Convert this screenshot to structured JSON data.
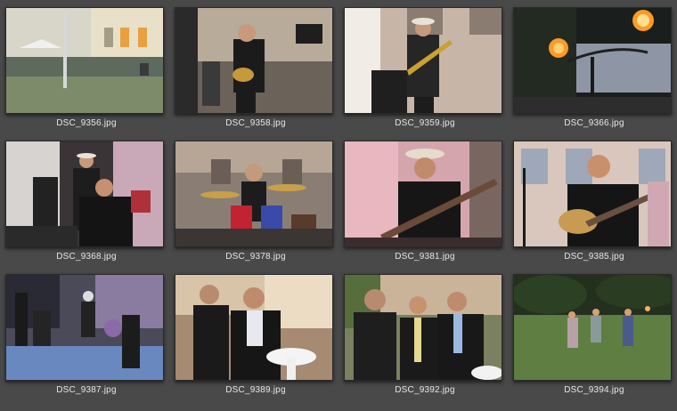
{
  "gallery": {
    "items": [
      {
        "caption": "DSC_9356.jpg"
      },
      {
        "caption": "DSC_9358.jpg"
      },
      {
        "caption": "DSC_9359.jpg"
      },
      {
        "caption": "DSC_9366.jpg"
      },
      {
        "caption": "DSC_9368.jpg"
      },
      {
        "caption": "DSC_9378.jpg"
      },
      {
        "caption": "DSC_9381.jpg"
      },
      {
        "caption": "DSC_9385.jpg"
      },
      {
        "caption": "DSC_9387.jpg"
      },
      {
        "caption": "DSC_9389.jpg"
      },
      {
        "caption": "DSC_9392.jpg"
      },
      {
        "caption": "DSC_9394.jpg"
      }
    ]
  },
  "colors": {
    "background": "#494949",
    "caption": "#e6e6e6"
  }
}
